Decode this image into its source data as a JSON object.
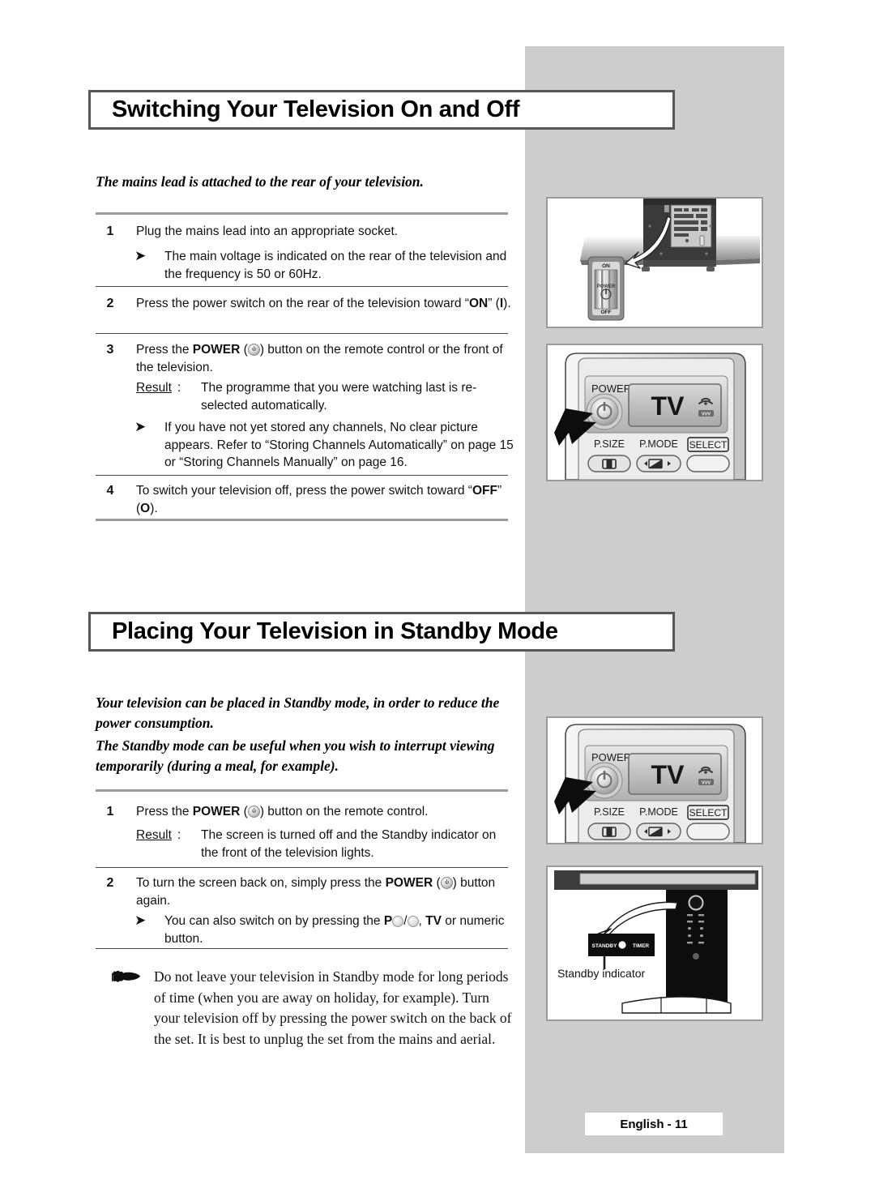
{
  "page": {
    "footer_label": "English - 11"
  },
  "sections": [
    {
      "title": "Switching Your Television On and Off",
      "intro": "The mains lead is attached to the rear of your television.",
      "steps": [
        {
          "num": "1",
          "text": "Plug the mains lead into an appropriate socket."
        },
        {
          "num": "2",
          "text": "Press the power switch on the rear of the television toward “ON” (I)."
        },
        {
          "num": "3",
          "text": "Press the POWER (⏻) button on the remote control or the front of the television."
        },
        {
          "num": "4",
          "text": "To switch your television off, press the power switch toward “OFF” (O)."
        }
      ],
      "notes": [
        "The main voltage is indicated on the rear of the television and the frequency is 50 or 60Hz.",
        "If you have not yet stored any channels, No clear picture appears. Refer to “Storing Channels Automatically” on page 15 or “Storing Channels Manually” on page 16."
      ],
      "result": {
        "label": "Result",
        "colon": ":",
        "text": "The programme that you were watching last is re-selected automatically."
      }
    },
    {
      "title": "Placing Your Television in Standby Mode",
      "intro_1": "Your television can be placed in Standby mode, in order to reduce the power consumption.",
      "intro_2": "The Standby mode can be useful when you wish to interrupt viewing temporarily (during a meal, for example).",
      "steps": [
        {
          "num": "1",
          "text": "Press the POWER (⏻) button on the remote control."
        },
        {
          "num": "2",
          "text": "To turn the screen back on, simply press the POWER (⏻) button again."
        }
      ],
      "result": {
        "label": "Result",
        "colon": ":",
        "text": "The screen is turned off and the Standby indicator on the front of the television lights."
      },
      "note": "You can also switch on by pressing the P○/○, TV or numeric button.",
      "caution": "Do not leave your television in Standby mode for long periods of time (when you are away on holiday, for example). Turn your television off by pressing the power switch on the back of the set. It is best to unplug the set from the mains and aerial."
    }
  ],
  "illustrations": {
    "rear_panel": {
      "switch_on_label": "ON",
      "switch_power_label": "POWER",
      "switch_off_label": "OFF"
    },
    "remote": {
      "power_label": "POWER",
      "screen_label": "TV",
      "psize_label": "P.SIZE",
      "pmode_label": "P.MODE",
      "select_label": "SELECT"
    },
    "standby_panel": {
      "standby_label": "STANDBY",
      "timer_label": "TIMER",
      "caption": "Standby indicator"
    }
  },
  "colors": {
    "band": "#cdcdcd",
    "title_border": "#565656",
    "panel_border": "#9b9b9b",
    "rule": "#4a4a4a"
  }
}
